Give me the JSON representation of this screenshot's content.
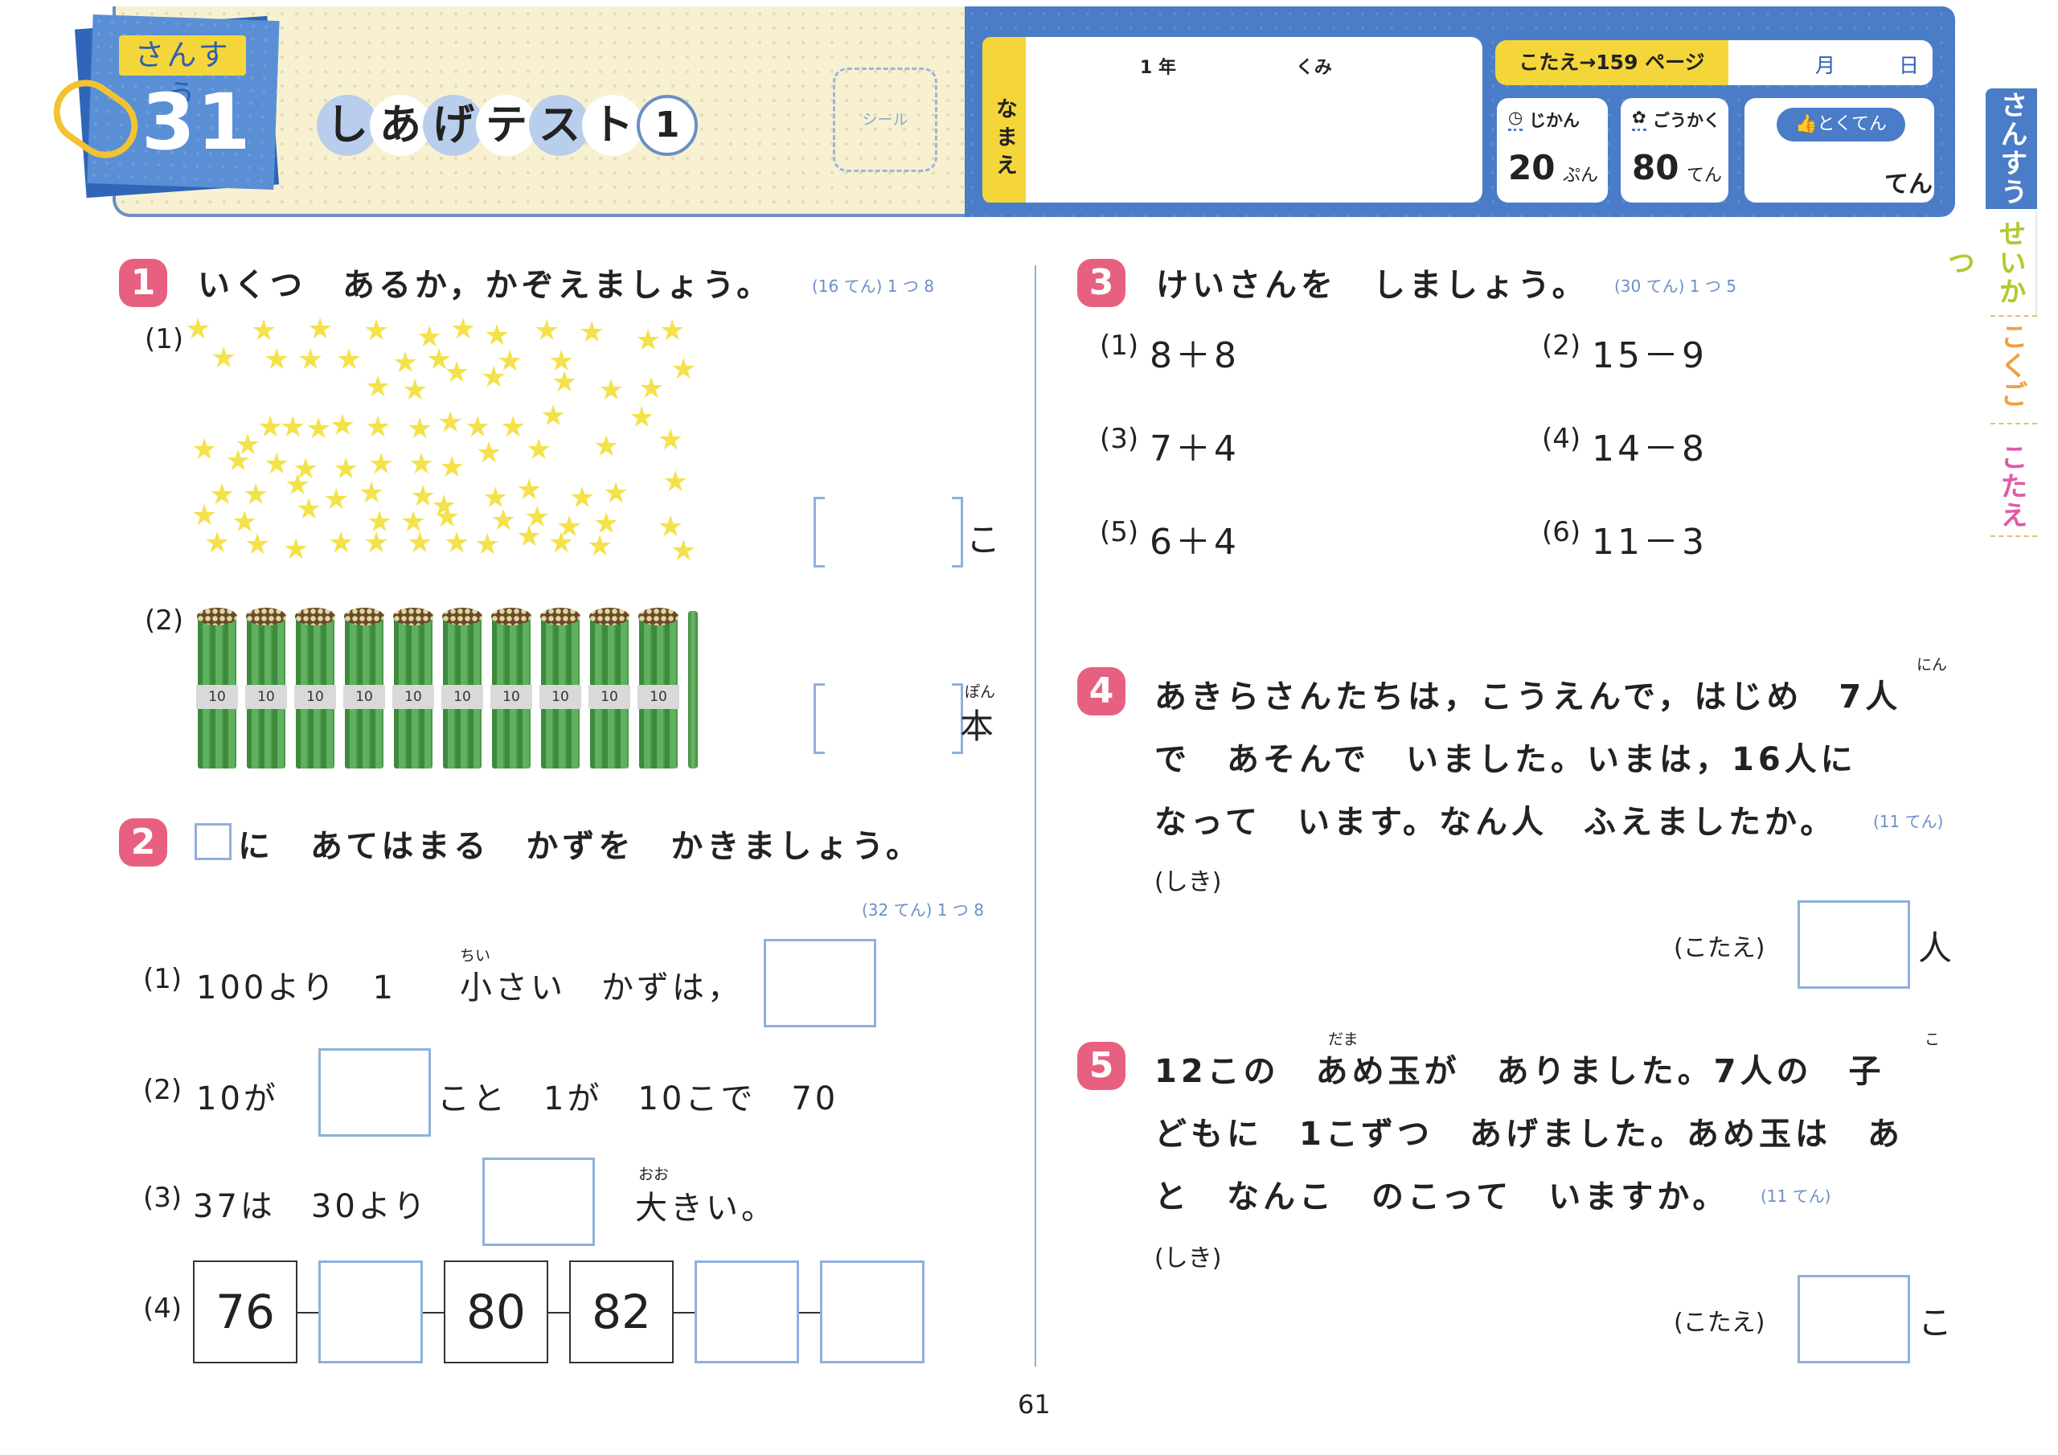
{
  "header": {
    "subject": "さんすう",
    "unit_number": "31",
    "title_chars": [
      "し",
      "あ",
      "げ",
      "テ",
      "ス",
      "ト",
      "1"
    ],
    "seal": "シール",
    "name_label": "なまえ",
    "grade": "1 年",
    "class": "くみ",
    "answer_ref": "こたえ→159 ページ",
    "month": "月",
    "day": "日",
    "time_label": "じかん",
    "time_value": "20",
    "time_unit": "ぷん",
    "pass_label": "ごうかく",
    "pass_value": "80",
    "pass_unit": "てん",
    "score_label": "とくてん",
    "score_unit": "てん"
  },
  "side_tabs": [
    "さんすう",
    "せいかつ",
    "こくご",
    "こたえ"
  ],
  "q1": {
    "num": "1",
    "text": "いくつ　あるか，かぞえましょう。",
    "points": "(16 てん) 1 つ 8",
    "sub1_label": "(1)",
    "sub1_unit": "こ",
    "sub2_label": "(2)",
    "sub2_unit": "本",
    "sub2_ruby": "ぽん",
    "band_label": "10"
  },
  "q2": {
    "num": "2",
    "text": "に　あてはまる　かずを　かきましょう。",
    "points": "(32 てん) 1 つ 8",
    "s1_label": "(1)",
    "s1_a": "100より　1　",
    "s1_ruby": "ちい",
    "s1_b": "小さい　かずは，",
    "s2_label": "(2)",
    "s2_a": "10が",
    "s2_b": "こと　1が　10こで　70",
    "s3_label": "(3)",
    "s3_a": "37は　30より",
    "s3_ruby": "おお",
    "s3_b": "大きい。",
    "s4_label": "(4)",
    "seq": [
      "76",
      "",
      "80",
      "82",
      "",
      ""
    ]
  },
  "q3": {
    "num": "3",
    "text": "けいさんを　しましょう。",
    "points": "(30 てん) 1 つ 5",
    "items": [
      {
        "label": "(1)",
        "expr": "8＋8"
      },
      {
        "label": "(2)",
        "expr": "15－9"
      },
      {
        "label": "(3)",
        "expr": "7＋4"
      },
      {
        "label": "(4)",
        "expr": "14－8"
      },
      {
        "label": "(5)",
        "expr": "6＋4"
      },
      {
        "label": "(6)",
        "expr": "11－3"
      }
    ]
  },
  "q4": {
    "num": "4",
    "line1": "あきらさんたちは，こうえんで，はじめ　7人",
    "ruby": "にん",
    "line2": "で　あそんで　いました。いまは，16人に",
    "line3": "なって　います。なん人　ふえましたか。",
    "points": "(11 てん)",
    "shiki": "(しき)",
    "kotae": "(こたえ)",
    "unit": "人"
  },
  "q5": {
    "num": "5",
    "line1": "12この　あめ玉が　ありました。7人の　子",
    "ruby_dama": "だま",
    "ruby_ko": "こ",
    "line2": "どもに　1こずつ　あげました。あめ玉は　あ",
    "line3": "と　なんこ　のこって　いますか。",
    "points": "(11 てん)",
    "shiki": "(しき)",
    "kotae": "(こたえ)",
    "unit": "こ"
  },
  "page_number": "61",
  "colors": {
    "accent_blue": "#4a7cc8",
    "accent_pink": "#e8607f",
    "accent_yellow": "#f5d63a"
  }
}
